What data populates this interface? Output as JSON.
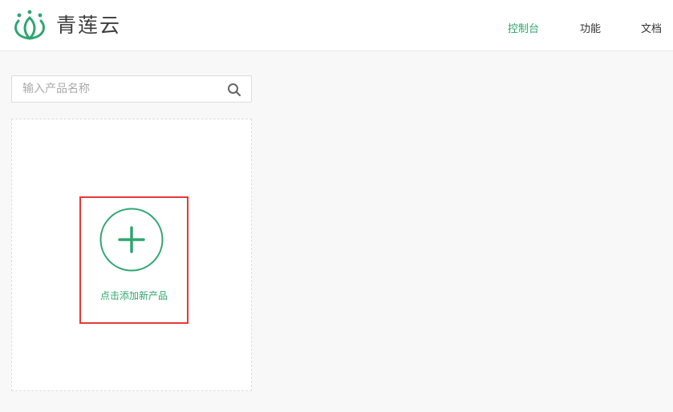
{
  "app": {
    "logo_icon": "lotus-icon",
    "name": "青莲云"
  },
  "nav": {
    "items": [
      {
        "label": "控制台",
        "active": true
      },
      {
        "label": "功能",
        "active": false
      },
      {
        "label": "文档",
        "active": false
      }
    ]
  },
  "search": {
    "placeholder": "输入产品名称",
    "value": "",
    "icon": "search-icon"
  },
  "add_product": {
    "icon": "plus-circle-icon",
    "label": "点击添加新产品"
  },
  "colors": {
    "brand": "#2fa56f",
    "highlight_border": "#e53935",
    "text": "#333333",
    "background": "#f8f8f8"
  }
}
